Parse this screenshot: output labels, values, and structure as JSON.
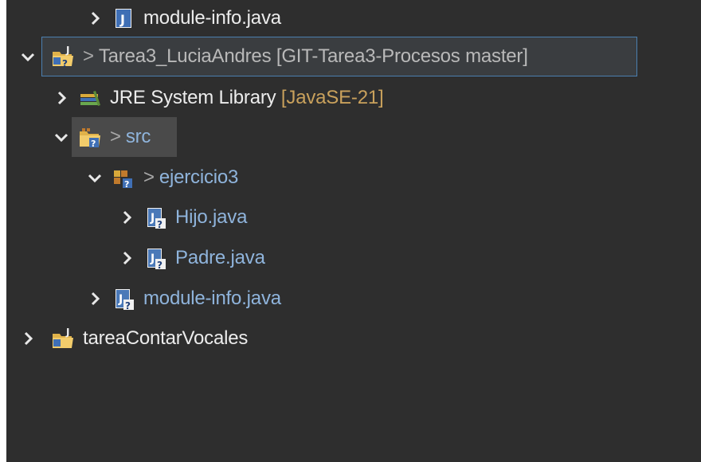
{
  "tree": {
    "rows": [
      {
        "label": "module-info.java",
        "chevron": "collapsed",
        "icon": "java-module-file-icon"
      },
      {
        "decorator": ">",
        "label": "Tarea3_LuciaAndres",
        "suffix": "[GIT-Tarea3-Procesos master]",
        "chevron": "expanded",
        "icon": "java-project-unknown-icon"
      },
      {
        "label": "JRE System Library",
        "suffix": "[JavaSE-21]",
        "chevron": "collapsed",
        "icon": "library-books-icon"
      },
      {
        "decorator": ">",
        "label": "src",
        "chevron": "expanded",
        "icon": "source-folder-unknown-icon"
      },
      {
        "decorator": ">",
        "label": "ejercicio3",
        "chevron": "expanded",
        "icon": "package-unknown-icon"
      },
      {
        "label": "Hijo.java",
        "chevron": "collapsed",
        "icon": "java-file-unknown-icon"
      },
      {
        "label": "Padre.java",
        "chevron": "collapsed",
        "icon": "java-file-unknown-icon"
      },
      {
        "label": "module-info.java",
        "chevron": "collapsed",
        "icon": "java-file-unknown-icon"
      },
      {
        "label": "tareaContarVocales",
        "chevron": "collapsed",
        "icon": "java-project-icon"
      }
    ]
  },
  "colors": {
    "background": "#2e2e2e",
    "text": "#ececec",
    "decorator": "#a8a8a8",
    "suffix_gold": "#c9a15c",
    "uncommitted_blue": "#8fb4dc",
    "selection_border": "#4b7fb0"
  }
}
